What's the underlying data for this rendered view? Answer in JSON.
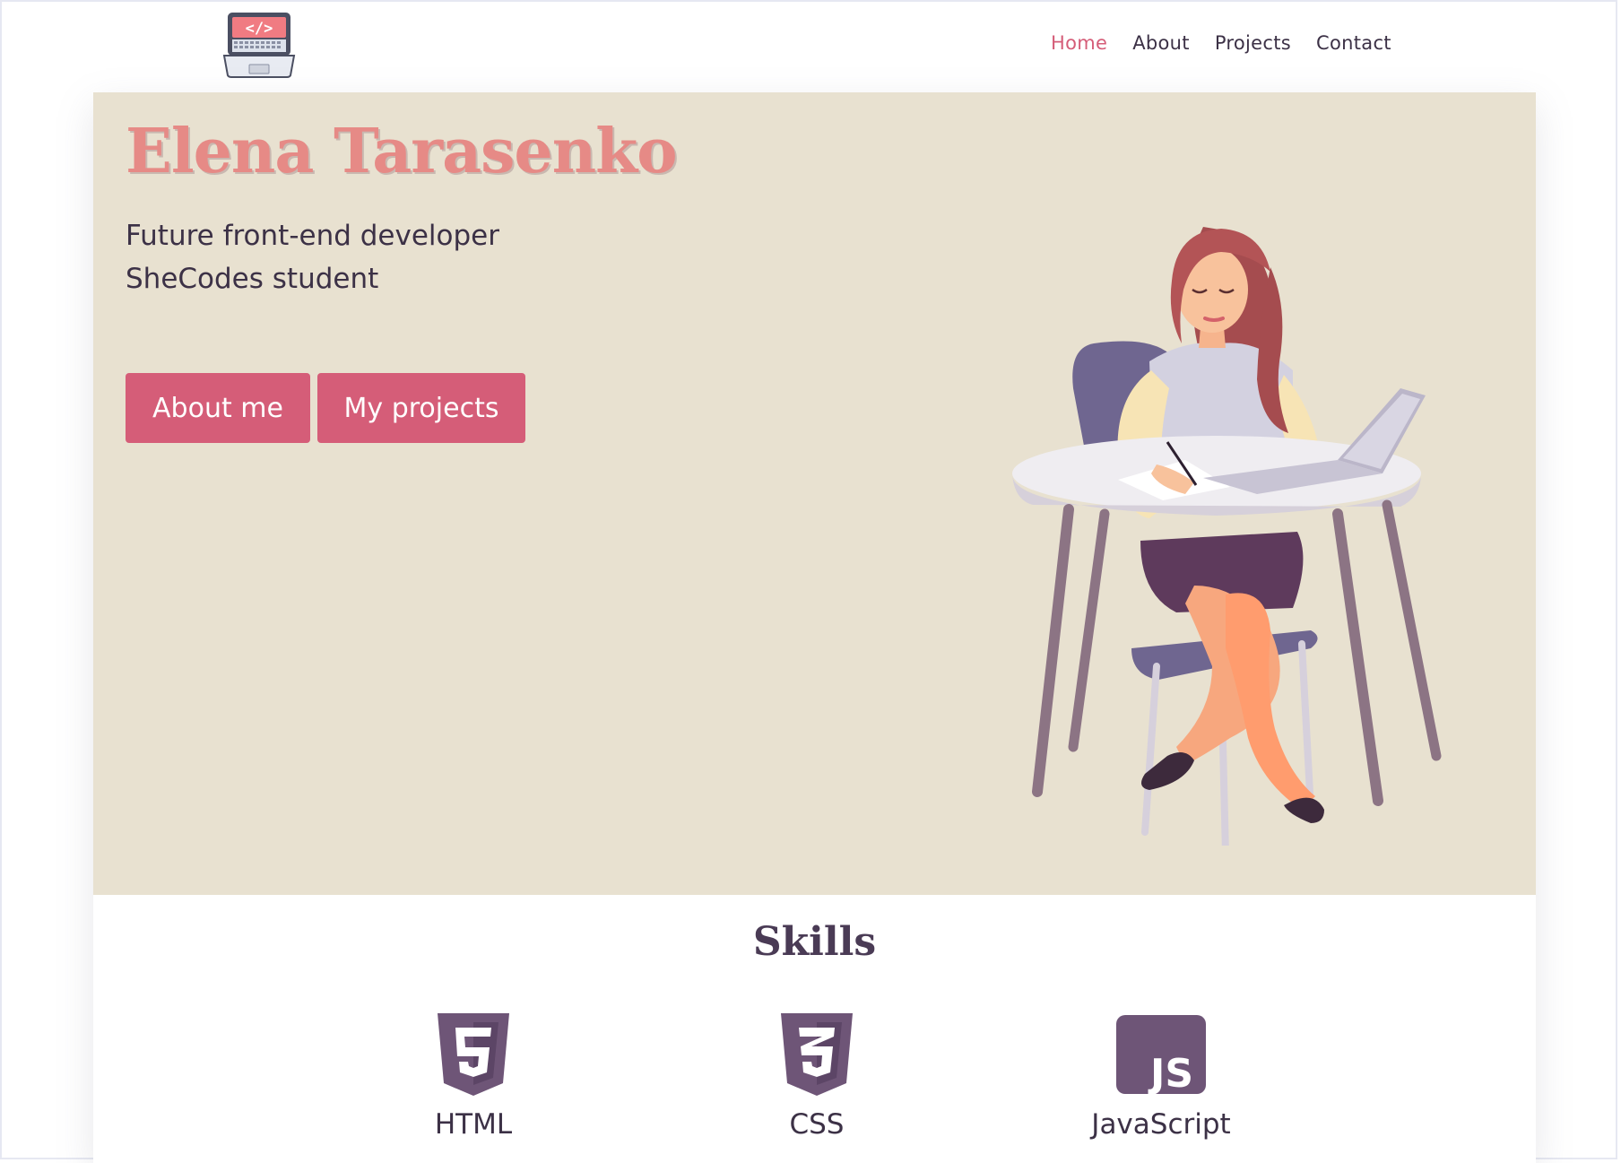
{
  "nav": {
    "logo_icon": "laptop-code-icon",
    "logo_code_text": "</>",
    "links": [
      {
        "label": "Home",
        "active": true
      },
      {
        "label": "About",
        "active": false
      },
      {
        "label": "Projects",
        "active": false
      },
      {
        "label": "Contact",
        "active": false
      }
    ]
  },
  "hero": {
    "name": "Elena Tarasenko",
    "subtitle_line1": "Future front-end developer",
    "subtitle_line2": "SheCodes student",
    "buttons": {
      "about": "About me",
      "projects": "My projects"
    },
    "illustration": "woman-at-desk-with-laptop-illustration"
  },
  "skills": {
    "title": "Skills",
    "items": [
      {
        "label": "HTML",
        "icon": "html5-icon",
        "glyph": "5"
      },
      {
        "label": "CSS",
        "icon": "css3-icon",
        "glyph": "3"
      },
      {
        "label": "JavaScript",
        "icon": "js-icon",
        "glyph": "JS"
      }
    ]
  },
  "colors": {
    "accent": "#d55d78",
    "name": "#e68a86",
    "hero_bg": "#e8e1d0",
    "text_dark": "#3c3146",
    "icon_purple": "#6e5577"
  }
}
